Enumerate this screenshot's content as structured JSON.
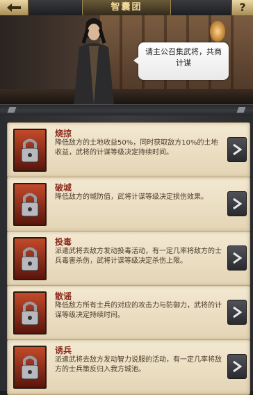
{
  "header": {
    "title": "智囊团",
    "help_label": "?"
  },
  "banner": {
    "speech": "请主公召集武将，共商计谋"
  },
  "strategies": [
    {
      "name": "烧掠",
      "icon": "fire-lock-icon",
      "desc": "降低敌方的土地收益50%，同时获取敌方10%的土地收益，武将的计谋等级决定持续时间。"
    },
    {
      "name": "破城",
      "icon": "castle-break-lock-icon",
      "desc": "降低敌方的城防值，武将计谋等级决定损伤效果。"
    },
    {
      "name": "投毒",
      "icon": "poison-lock-icon",
      "desc": "派遣武将去敌方发动投毒活动，有一定几率将敌方的士兵毒害杀伤，武将计谋等级决定杀伤上限。"
    },
    {
      "name": "散谣",
      "icon": "rumor-lock-icon",
      "desc": "降低敌方所有士兵的对应的攻击力与防御力，武将的计谋等级决定持续时间。"
    },
    {
      "name": "诱兵",
      "icon": "lure-lock-icon",
      "desc": "派遣武将去敌方发动智力说服的活动，有一定几率将敌方的士兵策反归入我方城池。"
    }
  ],
  "colors": {
    "card_bg": "#efe3c8",
    "title_red": "#8a2a1a",
    "gold": "#c9ad6d"
  }
}
